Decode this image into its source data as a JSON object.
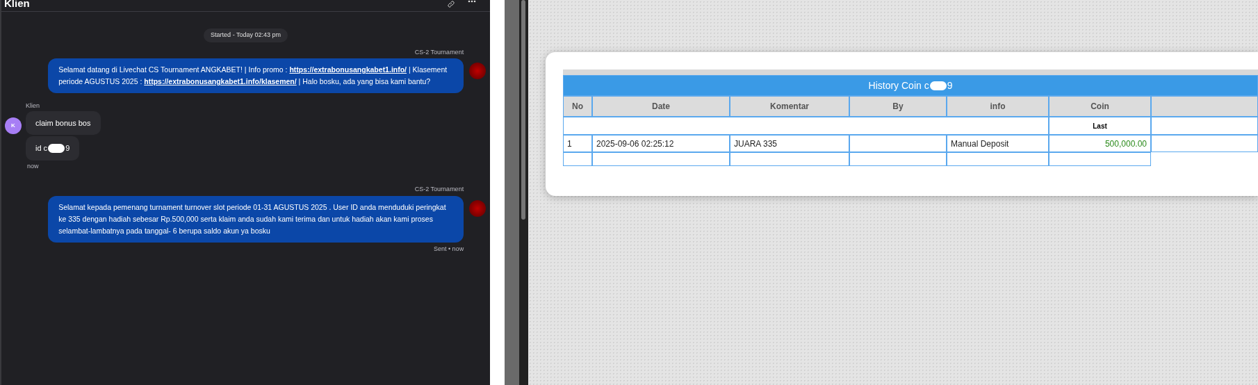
{
  "chat": {
    "title": "Klien",
    "date_divider": "Started - Today 02:43 pm",
    "messages": [
      {
        "kind": "agent",
        "sender": "CS-2 Tournament",
        "parts": [
          {
            "kind": "text",
            "text": "Selamat datang di Livechat CS Tournament ANGKABET! | Info promo : "
          },
          {
            "kind": "link",
            "text": "https://extrabonusangkabet1.info/"
          },
          {
            "kind": "text",
            "text": " | Klasement periode AGUSTUS 2025 : "
          },
          {
            "kind": "link",
            "text": "https://extrabonusangkabet1.info/klasemen/"
          },
          {
            "kind": "text",
            "text": " | Halo bosku, ada yang bisa kami bantu?"
          }
        ]
      },
      {
        "kind": "client",
        "sender": "Klien",
        "avatar": "K",
        "bubbles": [
          {
            "parts": [
              "claim bonus bos"
            ],
            "redacted": false
          },
          {
            "parts": [
              "id c",
              "9"
            ],
            "redacted": true
          }
        ],
        "time": "now"
      },
      {
        "kind": "agent",
        "sender": "CS-2 Tournament",
        "parts": [
          {
            "kind": "text",
            "text": "Selamat kepada pemenang turnament turnover slot periode 01-31 AGUSTUS 2025 . User ID anda menduduki peringkat ke 335 dengan hadiah sebesar Rp.500,000 serta klaim anda sudah kami terima dan untuk hadiah akan kami proses selambat-lambatnya pada tanggal- 6 berupa saldo akun ya bosku"
          }
        ],
        "status": "Sent • now"
      }
    ]
  },
  "history": {
    "title_parts": [
      "History Coin c",
      "9"
    ],
    "title_redacted": true,
    "columns": [
      "No",
      "Date",
      "Komentar",
      "By",
      "info",
      "Coin"
    ],
    "subheader": "Last",
    "rows": [
      {
        "cells": [
          "1",
          "2025-09-06 02:25:12",
          "JUARA 335",
          null,
          "Manual Deposit",
          "500,000.00"
        ]
      }
    ]
  }
}
